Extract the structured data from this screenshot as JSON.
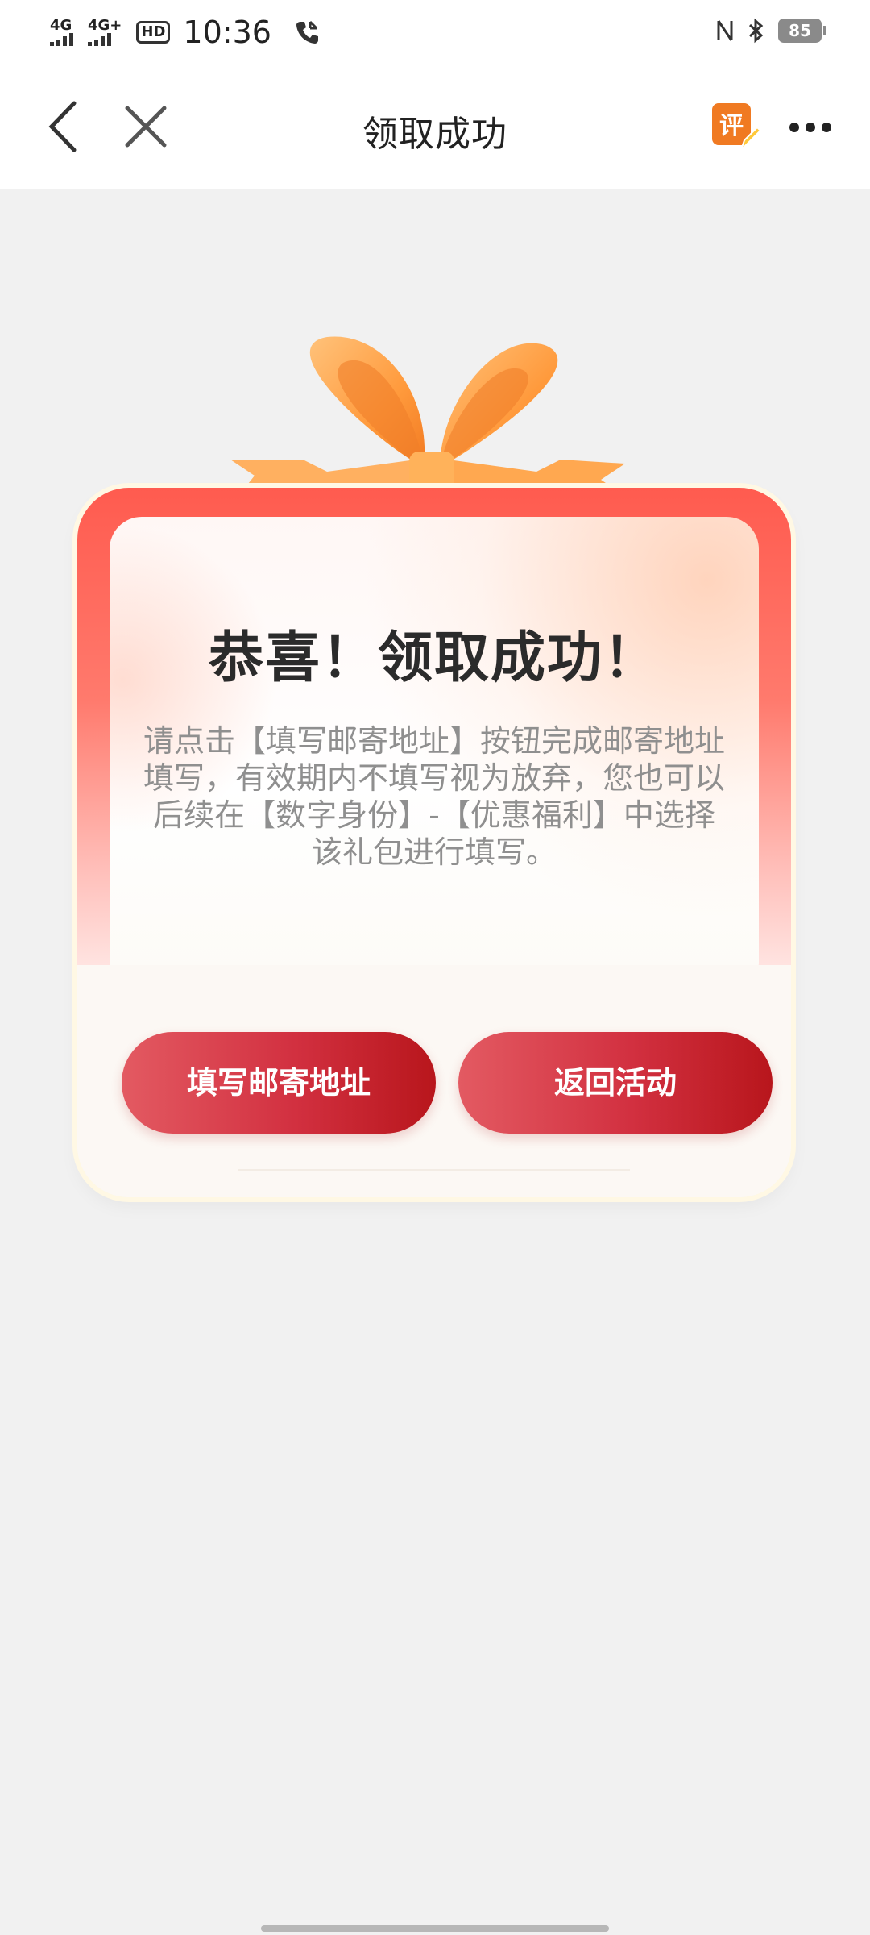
{
  "status_bar": {
    "signal1_label": "4G",
    "signal2_label": "4G+",
    "hd_label": "HD",
    "time": "10:36",
    "battery": "85"
  },
  "nav": {
    "title": "领取成功",
    "back_icon": "chevron-left-icon",
    "close_icon": "close-icon",
    "rate_icon_text": "评",
    "more_icon": "more-horizontal-icon"
  },
  "card": {
    "title": "恭喜！领取成功！",
    "description": "请点击【填写邮寄地址】按钮完成邮寄地址填写，有效期内不填写视为放弃，您也可以后续在【数字身份】-【优惠福利】中选择该礼包进行填写。",
    "fill_address_button": "填写邮寄地址",
    "back_to_activity_button": "返回活动"
  },
  "colors": {
    "accent_red": "#d23040",
    "ribbon_orange": "#ff9a3c",
    "card_top_red": "#ff5b4f"
  }
}
